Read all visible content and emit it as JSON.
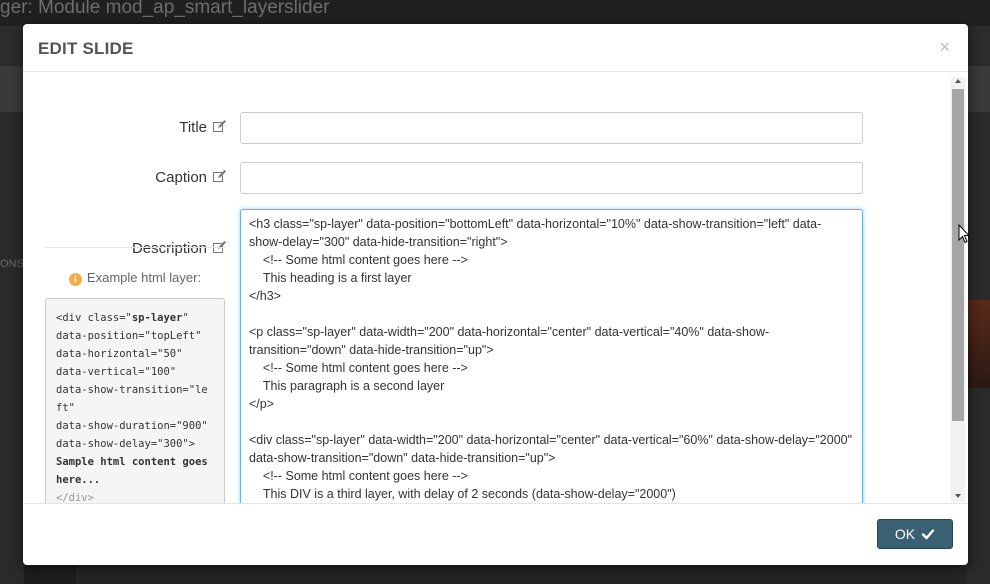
{
  "background": {
    "page_title": "ger: Module mod_ap_smart_layerslider",
    "left_partial_text": "ONS"
  },
  "modal": {
    "title": "EDIT SLIDE",
    "close_symbol": "×",
    "fields": {
      "title": {
        "label": "Title",
        "value": "",
        "icon": "edit-icon"
      },
      "caption": {
        "label": "Caption",
        "value": "",
        "icon": "edit-icon"
      },
      "description": {
        "label": "Description",
        "icon": "edit-icon",
        "value": "<h3 class=\"sp-layer\" data-position=\"bottomLeft\" data-horizontal=\"10%\" data-show-transition=\"left\" data-show-delay=\"300\" data-hide-transition=\"right\">\n    <!-- Some html content goes here -->\n    This heading is a first layer\n</h3>\n\n<p class=\"sp-layer\" data-width=\"200\" data-horizontal=\"center\" data-vertical=\"40%\" data-show-transition=\"down\" data-hide-transition=\"up\">\n    <!-- Some html content goes here -->\n    This paragraph is a second layer\n</p>\n\n<div class=\"sp-layer\" data-width=\"200\" data-horizontal=\"center\" data-vertical=\"60%\" data-show-delay=\"2000\" data-show-transition=\"down\" data-hide-transition=\"up\">\n    <!-- Some html content goes here -->\n    This DIV is a third layer, with delay of 2 seconds (data-show-delay=\"2000\")"
      }
    },
    "example": {
      "label": "Example html layer:",
      "icon": "info-icon",
      "lines": [
        "<div class=\"",
        "sp-layer",
        "\"",
        "data-position=\"topLeft\"",
        "data-horizontal=\"50\"",
        "data-vertical=\"100\"",
        "data-show-transition=\"left\"",
        "data-show-duration=\"900\"",
        "data-show-delay=\"300\">",
        "Sample html content goes here...",
        "</div>"
      ]
    },
    "ok_label": "OK"
  },
  "colors": {
    "ok_button": "#3a6173",
    "focus_border": "#66afe9",
    "info_icon": "#f0ad4e"
  }
}
